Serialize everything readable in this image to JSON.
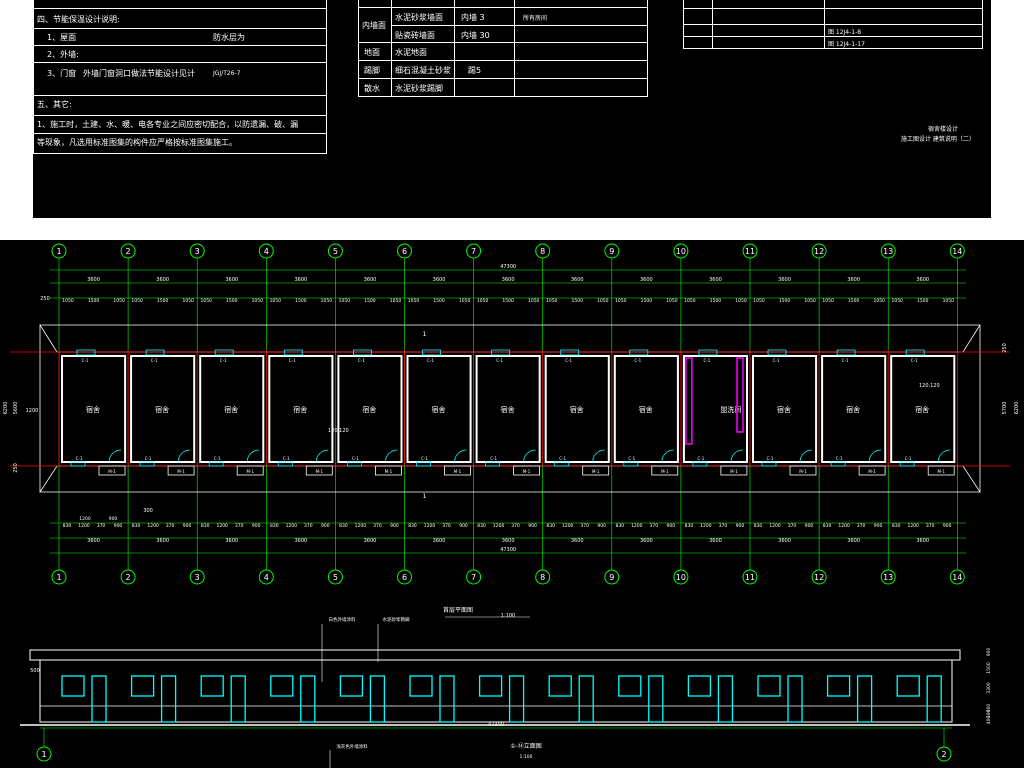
{
  "notes": {
    "section4_title": "四、节能保温设计说明:",
    "roof": "1、屋面",
    "roof_value": "防水层为",
    "walls": "2、外墙:",
    "doors": "3、门窗",
    "doors_value": "外墙门窗洞口做法节能设计见计",
    "doors_ref": "JGJ/T26-7",
    "section5_title": "五、其它:",
    "other_line1": "1、施工时，土建、水、暖、电各专业之间应密切配合，以防遗漏、破、漏",
    "other_line2": "等现象，凡选用标准图集的构件应严格按标准图集施工。"
  },
  "finish_table": {
    "rows": [
      {
        "part": "内墙面",
        "finish": "水泥砂浆墙面",
        "zone": "内墙 3",
        "extra": "所有房间"
      },
      {
        "part": "",
        "finish": "贴瓷砖墙面",
        "zone": "内墙 30",
        "extra": ""
      },
      {
        "part": "地面",
        "finish": "水泥地面",
        "zone": "",
        "extra": ""
      },
      {
        "part": "踢脚",
        "finish": "细石混凝土砂浆",
        "zone": "踢5",
        "extra": ""
      },
      {
        "part": "散水",
        "finish": "水泥砂浆踢脚",
        "zone": "",
        "extra": ""
      }
    ]
  },
  "ref_table": {
    "cells": [
      "图 12J4-1-8",
      "图 12J4-1-17"
    ]
  },
  "sheet_title": {
    "line1": "宿舍楼设计",
    "line2": "施工图设计 建筑说明（二）"
  },
  "grid_axes": [
    "1",
    "2",
    "3",
    "4",
    "5",
    "6",
    "7",
    "8",
    "9",
    "10",
    "11",
    "12",
    "13",
    "14"
  ],
  "dims": {
    "total": "47300",
    "bay": "3600",
    "left_ext": "250",
    "upper_subdims": [
      "1050",
      "1500",
      "1050"
    ],
    "lower_subdims": [
      "830",
      "1200",
      "370",
      "900"
    ],
    "left_side": [
      "6200",
      "5600",
      "1200",
      "250"
    ],
    "right_side": [
      "250",
      "5700",
      "6200"
    ],
    "offset_300": "300",
    "left_small": [
      "1200",
      "900"
    ]
  },
  "rooms": {
    "dorm": "宿舍",
    "toilet": "盥洗间",
    "window_tag": "C-1",
    "door_tag": "M-1",
    "section_mark": "1",
    "wall_thickness": "120,120"
  },
  "plan_title": "首层平面图",
  "plan_scale": "1:100",
  "elevation": {
    "title": "①-⑭立面图",
    "scale": "1:100",
    "label1": "白色外墙涂料",
    "label2": "水泥砂浆勒脚",
    "label3": "浅灰色外墙涂料",
    "top_mark": "500",
    "axis_left": "1",
    "axis_right": "2",
    "right_dims": [
      "900",
      "1500",
      "3300",
      "900",
      "300",
      "400"
    ]
  },
  "colors": {
    "grid": "#00ff00",
    "axis_line": "#ff0000",
    "wall": "#ffffff",
    "window": "#00ffff",
    "highlight": "#ff00ff",
    "dim_text": "#ffffff",
    "label": "#ffff00"
  }
}
